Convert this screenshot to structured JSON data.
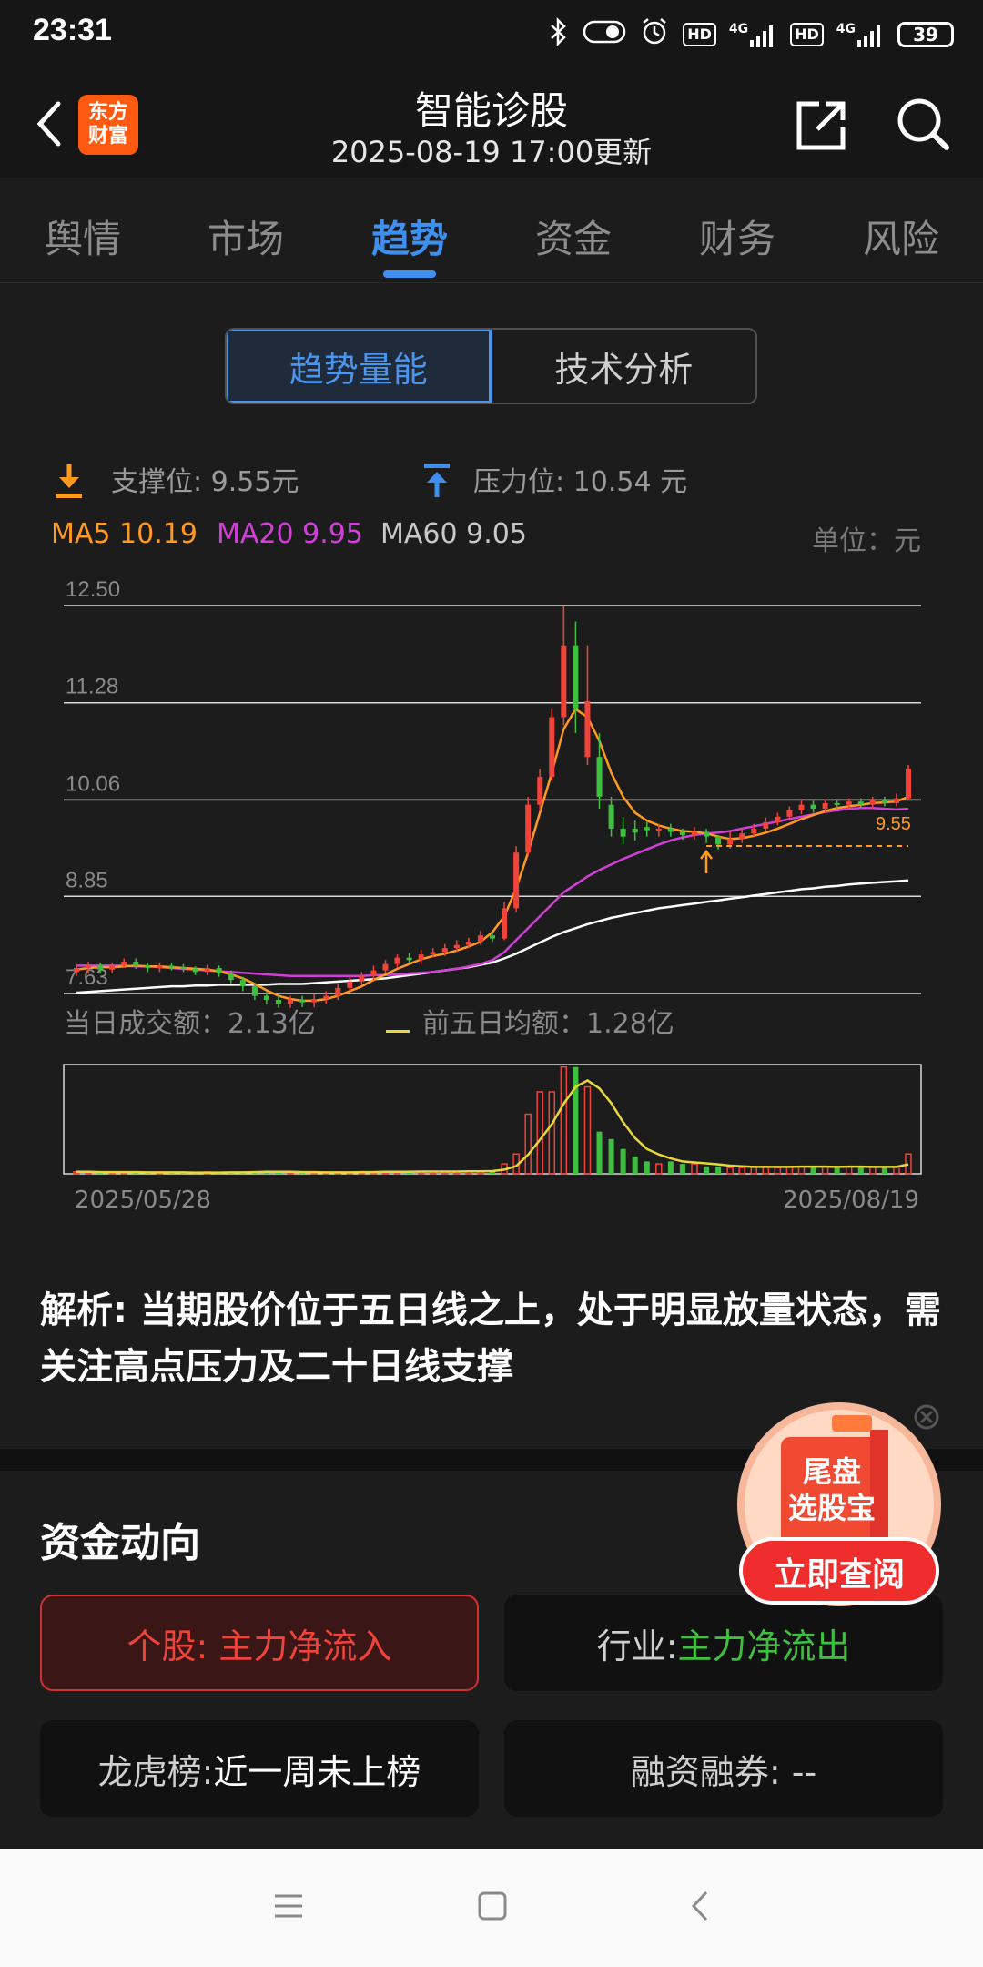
{
  "status": {
    "time": "23:31",
    "battery": "39",
    "net1": "4G",
    "net2": "4G",
    "hd1": "HD",
    "hd2": "HD"
  },
  "header": {
    "title": "智能诊股",
    "subtitle": "2025-08-19 17:00更新",
    "logo_line1": "东方",
    "logo_line2": "财富"
  },
  "tabs": [
    "舆情",
    "市场",
    "趋势",
    "资金",
    "财务",
    "风险"
  ],
  "segment": {
    "selected": "趋势量能",
    "other": "技术分析"
  },
  "legend": {
    "support": "支撑位: 9.55元",
    "pressure": "压力位: 10.54 元",
    "ma5": "MA5 10.19",
    "ma20": "MA20 9.95",
    "ma60": "MA60 9.05",
    "unit": "单位：元",
    "support_marker": "9.55"
  },
  "volume_legend": {
    "today": "当日成交额：2.13亿",
    "avg5": "前五日均额：1.28亿"
  },
  "colors": {
    "up": "#f0433a",
    "down": "#3fbf3f",
    "ma5": "#ff9a1f",
    "ma20": "#d040d8",
    "ma60": "#ffffff",
    "vol_avg": "#e6d83a",
    "accent": "#3d8ff0"
  },
  "chart_data": {
    "type": "candlestick",
    "x_start": "2025/05/28",
    "x_end": "2025/08/19",
    "y_ticks": [
      "12.50",
      "11.28",
      "10.06",
      "8.85",
      "7.63"
    ],
    "ylim": [
      7.63,
      12.5
    ],
    "support": 9.55,
    "pressure": 10.54,
    "candles": [
      [
        7.9,
        7.95,
        7.85,
        8.0
      ],
      [
        7.95,
        7.98,
        7.88,
        8.03
      ],
      [
        7.98,
        7.93,
        7.88,
        8.02
      ],
      [
        7.93,
        7.98,
        7.88,
        8.02
      ],
      [
        7.98,
        8.03,
        7.95,
        8.07
      ],
      [
        8.03,
        7.98,
        7.94,
        8.07
      ],
      [
        7.98,
        7.95,
        7.9,
        8.02
      ],
      [
        7.95,
        7.98,
        7.9,
        8.02
      ],
      [
        7.98,
        7.96,
        7.92,
        8.02
      ],
      [
        7.96,
        7.94,
        7.9,
        8.0
      ],
      [
        7.94,
        7.9,
        7.86,
        7.97
      ],
      [
        7.9,
        7.95,
        7.86,
        7.99
      ],
      [
        7.95,
        7.88,
        7.84,
        7.98
      ],
      [
        7.88,
        7.8,
        7.76,
        7.92
      ],
      [
        7.8,
        7.72,
        7.66,
        7.84
      ],
      [
        7.72,
        7.6,
        7.55,
        7.76
      ],
      [
        7.6,
        7.55,
        7.5,
        7.65
      ],
      [
        7.55,
        7.5,
        7.45,
        7.6
      ],
      [
        7.5,
        7.55,
        7.45,
        7.6
      ],
      [
        7.55,
        7.52,
        7.46,
        7.6
      ],
      [
        7.52,
        7.56,
        7.46,
        7.63
      ],
      [
        7.56,
        7.6,
        7.5,
        7.66
      ],
      [
        7.6,
        7.7,
        7.55,
        7.76
      ],
      [
        7.7,
        7.78,
        7.66,
        7.84
      ],
      [
        7.78,
        7.85,
        7.74,
        7.9
      ],
      [
        7.85,
        7.92,
        7.8,
        7.98
      ],
      [
        7.92,
        8.0,
        7.88,
        8.05
      ],
      [
        8.0,
        8.08,
        7.95,
        8.12
      ],
      [
        8.08,
        8.05,
        8.0,
        8.14
      ],
      [
        8.05,
        8.12,
        8.0,
        8.18
      ],
      [
        8.12,
        8.15,
        8.08,
        8.2
      ],
      [
        8.15,
        8.2,
        8.1,
        8.25
      ],
      [
        8.2,
        8.24,
        8.15,
        8.3
      ],
      [
        8.24,
        8.28,
        8.2,
        8.33
      ],
      [
        8.28,
        8.36,
        8.24,
        8.42
      ],
      [
        8.36,
        8.32,
        8.28,
        8.4
      ],
      [
        8.32,
        8.7,
        8.3,
        8.78
      ],
      [
        8.7,
        9.4,
        8.65,
        9.48
      ],
      [
        9.4,
        10.0,
        9.35,
        10.1
      ],
      [
        10.0,
        10.35,
        9.92,
        10.45
      ],
      [
        10.35,
        11.1,
        10.3,
        11.2
      ],
      [
        11.1,
        12.0,
        11.0,
        12.5
      ],
      [
        12.0,
        11.2,
        10.9,
        12.3
      ],
      [
        10.6,
        11.3,
        10.5,
        12.0
      ],
      [
        10.6,
        10.1,
        9.95,
        10.9
      ],
      [
        10.0,
        9.7,
        9.6,
        10.1
      ],
      [
        9.7,
        9.6,
        9.5,
        9.85
      ],
      [
        9.7,
        9.65,
        9.55,
        9.8
      ],
      [
        9.72,
        9.68,
        9.6,
        9.78
      ],
      [
        9.68,
        9.7,
        9.6,
        9.76
      ],
      [
        9.7,
        9.66,
        9.6,
        9.76
      ],
      [
        9.66,
        9.62,
        9.56,
        9.7
      ],
      [
        9.62,
        9.66,
        9.56,
        9.72
      ],
      [
        9.66,
        9.6,
        9.52,
        9.7
      ],
      [
        9.6,
        9.5,
        9.44,
        9.62
      ],
      [
        9.5,
        9.57,
        9.45,
        9.66
      ],
      [
        9.57,
        9.64,
        9.52,
        9.7
      ],
      [
        9.64,
        9.7,
        9.6,
        9.76
      ],
      [
        9.7,
        9.78,
        9.66,
        9.84
      ],
      [
        9.78,
        9.85,
        9.74,
        9.9
      ],
      [
        9.85,
        9.93,
        9.8,
        9.98
      ],
      [
        9.93,
        10.0,
        9.88,
        10.06
      ],
      [
        10.0,
        9.95,
        9.9,
        10.05
      ],
      [
        9.95,
        10.02,
        9.9,
        10.07
      ],
      [
        10.02,
        10.0,
        9.95,
        10.06
      ],
      [
        10.0,
        10.04,
        9.96,
        10.08
      ],
      [
        10.04,
        10.0,
        9.96,
        10.08
      ],
      [
        10.0,
        10.06,
        9.96,
        10.1
      ],
      [
        10.06,
        10.02,
        9.98,
        10.1
      ],
      [
        10.02,
        10.08,
        9.98,
        10.14
      ],
      [
        10.08,
        10.45,
        10.05,
        10.5
      ]
    ],
    "ma5": [
      7.93,
      7.95,
      7.96,
      7.96,
      7.97,
      7.98,
      7.97,
      7.97,
      7.96,
      7.95,
      7.94,
      7.93,
      7.91,
      7.87,
      7.82,
      7.75,
      7.67,
      7.6,
      7.56,
      7.54,
      7.54,
      7.56,
      7.6,
      7.66,
      7.72,
      7.8,
      7.87,
      7.94,
      8.0,
      8.06,
      8.1,
      8.13,
      8.17,
      8.22,
      8.28,
      8.4,
      8.6,
      8.95,
      9.4,
      9.9,
      10.4,
      10.95,
      11.2,
      11.1,
      10.8,
      10.4,
      10.1,
      9.9,
      9.8,
      9.74,
      9.7,
      9.67,
      9.66,
      9.64,
      9.6,
      9.57,
      9.58,
      9.61,
      9.65,
      9.7,
      9.76,
      9.82,
      9.87,
      9.92,
      9.96,
      9.98,
      10.0,
      10.02,
      10.03,
      10.04,
      10.1
    ],
    "ma20": [
      7.98,
      7.98,
      7.98,
      7.98,
      7.98,
      7.97,
      7.97,
      7.96,
      7.95,
      7.94,
      7.93,
      7.92,
      7.91,
      7.9,
      7.89,
      7.88,
      7.87,
      7.86,
      7.85,
      7.85,
      7.85,
      7.85,
      7.85,
      7.85,
      7.85,
      7.86,
      7.86,
      7.87,
      7.88,
      7.89,
      7.9,
      7.92,
      7.94,
      7.97,
      8.0,
      8.05,
      8.15,
      8.3,
      8.45,
      8.6,
      8.75,
      8.9,
      9.0,
      9.1,
      9.18,
      9.25,
      9.32,
      9.38,
      9.44,
      9.5,
      9.55,
      9.59,
      9.62,
      9.64,
      9.65,
      9.67,
      9.7,
      9.73,
      9.76,
      9.79,
      9.82,
      9.85,
      9.88,
      9.91,
      9.93,
      9.95,
      9.96,
      9.96,
      9.95,
      9.94,
      9.95
    ],
    "ma60": [
      7.64,
      7.65,
      7.66,
      7.67,
      7.68,
      7.69,
      7.7,
      7.71,
      7.72,
      7.72,
      7.73,
      7.73,
      7.74,
      7.74,
      7.74,
      7.74,
      7.74,
      7.75,
      7.75,
      7.75,
      7.76,
      7.77,
      7.78,
      7.79,
      7.8,
      7.81,
      7.82,
      7.84,
      7.86,
      7.88,
      7.9,
      7.92,
      7.94,
      7.96,
      7.99,
      8.02,
      8.07,
      8.13,
      8.2,
      8.27,
      8.34,
      8.4,
      8.45,
      8.5,
      8.54,
      8.58,
      8.61,
      8.64,
      8.67,
      8.7,
      8.72,
      8.74,
      8.76,
      8.78,
      8.8,
      8.82,
      8.84,
      8.86,
      8.88,
      8.9,
      8.92,
      8.94,
      8.95,
      8.97,
      8.98,
      9.0,
      9.01,
      9.02,
      9.03,
      9.04,
      9.05
    ],
    "volume": [
      0.08,
      0.07,
      0.06,
      0.06,
      0.07,
      0.06,
      0.05,
      0.06,
      0.05,
      0.05,
      0.05,
      0.05,
      0.06,
      0.07,
      0.08,
      0.09,
      0.08,
      0.07,
      0.06,
      0.06,
      0.06,
      0.06,
      0.07,
      0.07,
      0.08,
      0.08,
      0.09,
      0.09,
      0.08,
      0.09,
      0.09,
      0.1,
      0.1,
      0.11,
      0.12,
      0.12,
      0.4,
      0.8,
      2.4,
      3.3,
      3.3,
      4.3,
      4.3,
      3.5,
      1.7,
      1.4,
      1.0,
      0.7,
      0.5,
      0.4,
      0.5,
      0.4,
      0.4,
      0.3,
      0.3,
      0.25,
      0.25,
      0.3,
      0.3,
      0.25,
      0.3,
      0.3,
      0.28,
      0.3,
      0.25,
      0.3,
      0.28,
      0.3,
      0.25,
      0.28,
      0.8
    ],
    "vol_avg": [
      0.08,
      0.08,
      0.07,
      0.07,
      0.07,
      0.07,
      0.06,
      0.06,
      0.06,
      0.06,
      0.05,
      0.05,
      0.05,
      0.06,
      0.06,
      0.07,
      0.08,
      0.08,
      0.08,
      0.07,
      0.07,
      0.06,
      0.06,
      0.06,
      0.07,
      0.07,
      0.08,
      0.08,
      0.08,
      0.09,
      0.09,
      0.09,
      0.09,
      0.1,
      0.1,
      0.11,
      0.17,
      0.31,
      0.77,
      1.37,
      2.0,
      2.82,
      3.5,
      3.76,
      3.44,
      2.84,
      2.08,
      1.44,
      1.0,
      0.78,
      0.62,
      0.5,
      0.46,
      0.42,
      0.38,
      0.33,
      0.3,
      0.28,
      0.28,
      0.28,
      0.28,
      0.29,
      0.29,
      0.29,
      0.28,
      0.29,
      0.29,
      0.28,
      0.28,
      0.28,
      0.38
    ]
  },
  "analysis": {
    "label": "解析:",
    "text": "当期股价位于五日线之上，处于明显放量状态，需关注高点压力及二十日线支撑"
  },
  "fund": {
    "title": "资金动向",
    "stock_label": "个股: 主力净流入",
    "industry_prefix": "行业: ",
    "industry_value": "主力净流出",
    "dragon_prefix": "龙虎榜: ",
    "dragon_value": "近一周未上榜",
    "margin": "融资融券: --"
  },
  "promo": {
    "line1": "尾盘",
    "line2": "选股宝",
    "button": "立即查阅"
  }
}
